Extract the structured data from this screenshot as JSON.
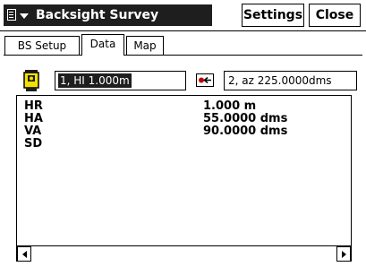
{
  "window": {
    "title": "Backsight Survey",
    "settings_label": "Settings",
    "close_label": "Close"
  },
  "tabs": [
    {
      "label": "BS Setup",
      "selected": false
    },
    {
      "label": "Data",
      "selected": true
    },
    {
      "label": "Map",
      "selected": false
    }
  ],
  "toolbar": {
    "station_icon": "total-station-icon",
    "station_value": "1, HI 1.000m",
    "backsight_icon": "backsight-target-icon",
    "backsight_value": "2, az 225.0000dms"
  },
  "data": {
    "rows": [
      {
        "label": "HR",
        "value": "1.000 m"
      },
      {
        "label": "HA",
        "value": "55.0000 dms"
      },
      {
        "label": "VA",
        "value": "90.0000 dms"
      },
      {
        "label": "SD",
        "value": ""
      }
    ]
  },
  "colors": {
    "titlebar_dark": "#1e1e1e",
    "station_yellow": "#f2e200",
    "accent_red": "#c00000"
  }
}
